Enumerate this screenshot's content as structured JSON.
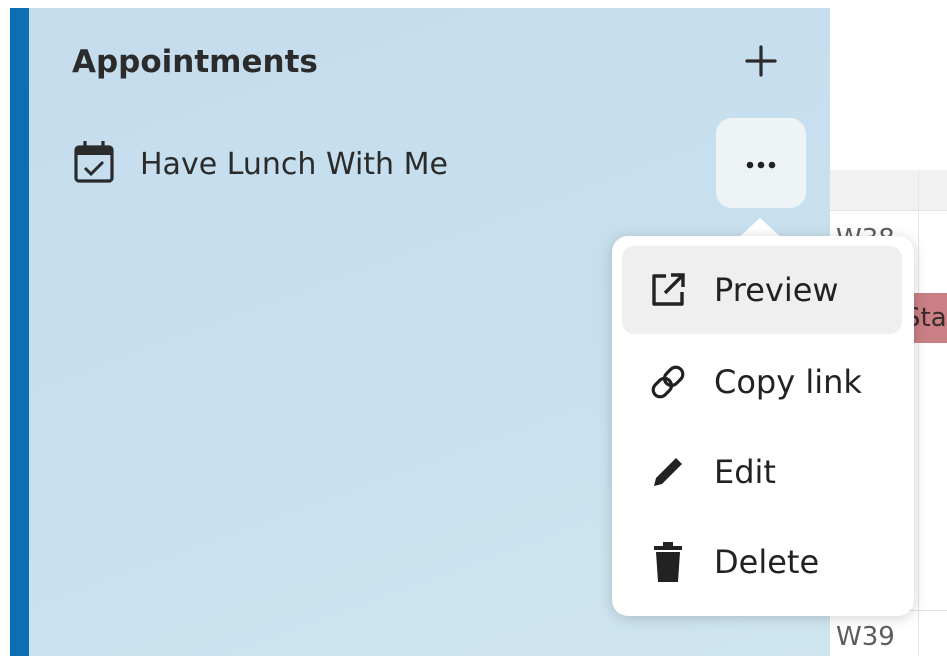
{
  "appointments": {
    "title": "Appointments",
    "add_icon": "plus-icon",
    "items": [
      {
        "label": "Have Lunch With Me",
        "icon": "calendar-check-icon",
        "actions_icon": "more-horizontal-icon"
      }
    ]
  },
  "context_menu": {
    "items": [
      {
        "label": "Preview",
        "icon": "external-link-icon"
      },
      {
        "label": "Copy link",
        "icon": "link-icon"
      },
      {
        "label": "Edit",
        "icon": "pencil-icon"
      },
      {
        "label": "Delete",
        "icon": "trash-icon"
      }
    ]
  },
  "calendar": {
    "week_labels": [
      "W38",
      "W39"
    ],
    "event_text": "Sta"
  },
  "colors": {
    "panel_bg": "#c8e0ee",
    "accent": "#0d6fb3",
    "event_chip": "#c97f84"
  }
}
